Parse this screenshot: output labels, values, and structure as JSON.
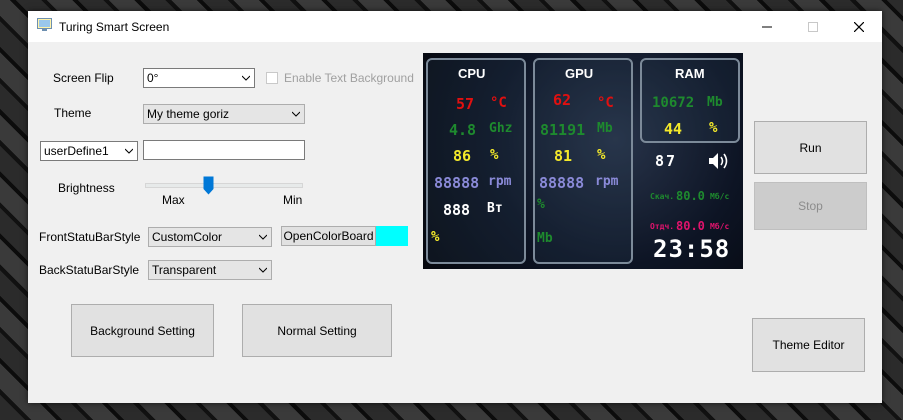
{
  "window": {
    "title": "Turing Smart Screen"
  },
  "screen_flip": {
    "label": "Screen Flip",
    "value": "0°",
    "enable_text_bg": "Enable Text Background"
  },
  "theme": {
    "label": "Theme",
    "value": "My theme goriz"
  },
  "user_define": {
    "value": "userDefine1",
    "text": ""
  },
  "brightness": {
    "label": "Brightness",
    "max": "Max",
    "min": "Min",
    "level": 0.43
  },
  "front_status": {
    "label": "FrontStatuBarStyle",
    "value": "CustomColor",
    "button": "OpenColorBoard",
    "color": "#00ffff"
  },
  "back_status": {
    "label": "BackStatuBarStyle",
    "value": "Transparent"
  },
  "buttons": {
    "background_setting": "Background Setting",
    "normal_setting": "Normal Setting",
    "run": "Run",
    "stop": "Stop",
    "theme_editor": "Theme Editor"
  },
  "preview": {
    "cpu": {
      "header": "CPU",
      "temp": "57",
      "temp_unit": "°C",
      "freq": "4.8",
      "freq_unit": "Ghz",
      "load": "86",
      "load_unit": "%",
      "rpm": "88888",
      "rpm_unit": "rpm",
      "power": "888",
      "power_unit": "Вт",
      "pct": "%"
    },
    "gpu": {
      "header": "GPU",
      "temp": "62",
      "temp_unit": "°C",
      "mem": "81191",
      "mem_unit": "Mb",
      "load": "81",
      "load_unit": "%",
      "rpm": "88888",
      "rpm_unit": "rpm",
      "pct": "%",
      "mb": "Mb"
    },
    "ram": {
      "header": "RAM",
      "used": "10672",
      "used_unit": "Mb",
      "load": "44",
      "load_unit": "%"
    },
    "volume": "87",
    "net_down_label": "Скач.",
    "net_down": "80.0",
    "net_down_unit": "Мб/с",
    "net_up_label": "Отдч.",
    "net_up": "80.0",
    "net_up_unit": "Мб/с",
    "time": "23:58"
  }
}
